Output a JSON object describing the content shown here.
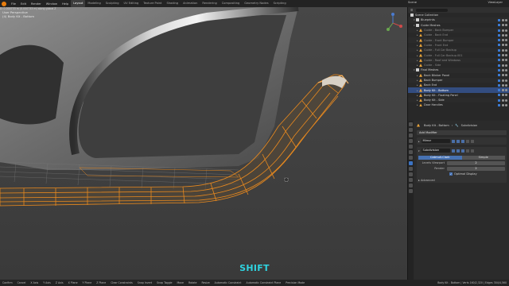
{
  "topbar": {
    "menus": [
      "File",
      "Edit",
      "Render",
      "Window",
      "Help"
    ],
    "workspaces": [
      "Layout",
      "Modeling",
      "Sculpting",
      "UV Editing",
      "Texture Paint",
      "Shading",
      "Animation",
      "Rendering",
      "Compositing",
      "Geometry Nodes",
      "Scripting"
    ],
    "active_workspace": "Layout",
    "scene": "Scene",
    "view_layer": "ViewLayer"
  },
  "viewport": {
    "header_text": "D: 0.000733 m (0.000733 m) along global Z",
    "view_name": "User Perspective",
    "object_name": "(4) Body Kit - Bottom",
    "key_overlay": "SHIFT",
    "accent": "#2fd3e0",
    "mesh_color": "#e8891f"
  },
  "outliner": {
    "root": "Scene Collection",
    "rows": [
      {
        "label": "Blueprints",
        "kind": "coll",
        "depth": 1,
        "tag": "",
        "sel": false,
        "dim": false
      },
      {
        "label": "Guide Meshes",
        "kind": "coll",
        "depth": 1,
        "tag": "",
        "sel": false,
        "dim": false
      },
      {
        "label": "Guide - Back Bumper",
        "kind": "mesh",
        "depth": 2,
        "tag": "",
        "sel": false,
        "dim": true
      },
      {
        "label": "Guide - Back End",
        "kind": "mesh",
        "depth": 2,
        "tag": "",
        "sel": false,
        "dim": true
      },
      {
        "label": "Guide - Front Bumper",
        "kind": "mesh",
        "depth": 2,
        "tag": "",
        "sel": false,
        "dim": true
      },
      {
        "label": "Guide - Front End",
        "kind": "mesh",
        "depth": 2,
        "tag": "",
        "sel": false,
        "dim": true
      },
      {
        "label": "Guide - Full Car Backup",
        "kind": "mesh",
        "depth": 2,
        "tag": "",
        "sel": false,
        "dim": true
      },
      {
        "label": "Guide - Full Car Backup.001",
        "kind": "mesh",
        "depth": 2,
        "tag": "",
        "sel": false,
        "dim": true
      },
      {
        "label": "Guide - Roof and Windows",
        "kind": "mesh",
        "depth": 2,
        "tag": "",
        "sel": false,
        "dim": true
      },
      {
        "label": "Guide - Side",
        "kind": "mesh",
        "depth": 2,
        "tag": "",
        "sel": false,
        "dim": true
      },
      {
        "label": "Final Meshes",
        "kind": "coll",
        "depth": 1,
        "tag": "",
        "sel": false,
        "dim": false
      },
      {
        "label": "Back Blinker Panel",
        "kind": "mesh",
        "depth": 2,
        "tag": "",
        "sel": false,
        "dim": false
      },
      {
        "label": "Back Bumper",
        "kind": "mesh",
        "depth": 2,
        "tag": "",
        "sel": false,
        "dim": false
      },
      {
        "label": "Back End",
        "kind": "mesh",
        "depth": 2,
        "tag": "",
        "sel": false,
        "dim": false
      },
      {
        "label": "Body Kit - Bottom",
        "kind": "mesh",
        "depth": 2,
        "tag": "",
        "sel": true,
        "dim": false
      },
      {
        "label": "Body Kit - Floating Panel",
        "kind": "mesh",
        "depth": 2,
        "tag": "",
        "sel": false,
        "dim": false
      },
      {
        "label": "Body Kit - Side",
        "kind": "mesh",
        "depth": 2,
        "tag": "",
        "sel": false,
        "dim": false
      },
      {
        "label": "Door Handles",
        "kind": "mesh",
        "depth": 2,
        "tag": "",
        "sel": false,
        "dim": false
      }
    ]
  },
  "properties": {
    "crumb_object": "Body Kit - Bottom",
    "crumb_modifier": "Subdivision",
    "add_modifier": "Add Modifier",
    "modifiers": [
      {
        "name": "Mirror"
      },
      {
        "name": "Subdivision"
      }
    ],
    "subdiv_mode": {
      "catmull": "Catmull-Clark",
      "simple": "Simple"
    },
    "levels_viewport_label": "Levels Viewport",
    "levels_viewport": "2",
    "render_label": "Render",
    "render": "2",
    "optimal_display": "Optimal Display",
    "advanced": "Advanced"
  },
  "statusbar": {
    "items": [
      "Confirm",
      "Cancel",
      "X Axis",
      "Y Axis",
      "Z Axis",
      "X Plane",
      "Y Plane",
      "Z Plane",
      "Clear Constraints",
      "Snap Invert",
      "Snap Toggle",
      "Move",
      "Rotate",
      "Resize",
      "Automatic Constraint",
      "Automatic Constraint Plane",
      "Precision Mode"
    ],
    "stats": "Body Kit - Bottom | Verts 160/2,320 | Edges 304/4,560"
  }
}
